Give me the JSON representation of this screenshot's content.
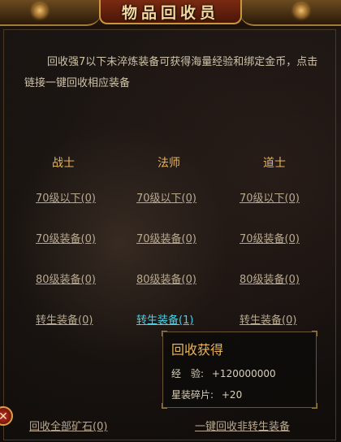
{
  "header": {
    "title": "物品回收员"
  },
  "description": "回收强7以下未淬炼装备可获得海量经验和绑定金币，点击链接一键回收相应装备",
  "columns": [
    {
      "title": "战士",
      "links": [
        "70级以下(0)",
        "70级装备(0)",
        "80级装备(0)",
        "转生装备(0)"
      ]
    },
    {
      "title": "法师",
      "links": [
        "70级以下(0)",
        "70级装备(0)",
        "80级装备(0)",
        "转生装备(1)"
      ]
    },
    {
      "title": "道士",
      "links": [
        "70级以下(0)",
        "70级装备(0)",
        "80级装备(0)",
        "转生装备(0)"
      ]
    }
  ],
  "tooltip": {
    "title": "回收获得",
    "exp_label": "经　验:",
    "exp_value": "+120000000",
    "fragment_label": "星装碎片:",
    "fragment_value": "+20"
  },
  "footer": {
    "recycle_ore": "回收全部矿石(0)",
    "recycle_non_rebirth": "一键回收非转生装备"
  },
  "close_icon": "close-icon",
  "colors": {
    "accent": "#e8b45a",
    "highlight_link": "#49d0e8",
    "link": "#b8a990"
  }
}
